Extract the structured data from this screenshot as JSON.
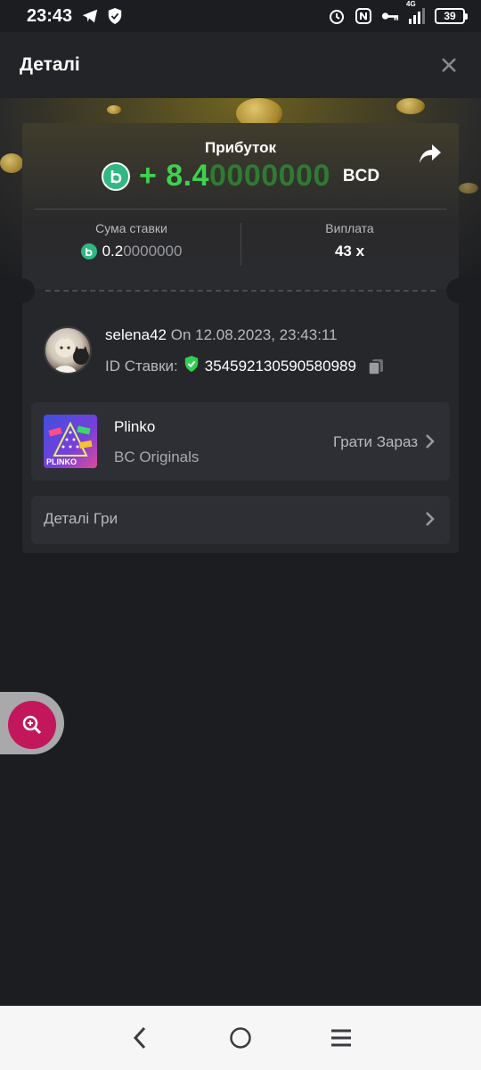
{
  "status_bar": {
    "time": "23:43",
    "network": "4G",
    "battery": "39",
    "icons_left": [
      "telegram-icon",
      "shield-check-icon"
    ],
    "icons_right": [
      "alarm-icon",
      "nfc-icon",
      "key-icon",
      "signal-icon",
      "battery-icon"
    ]
  },
  "header": {
    "title": "Деталі",
    "close_icon": "close-icon"
  },
  "summary": {
    "profit_label": "Прибуток",
    "profit_sign": "+ ",
    "profit_main": "8.4",
    "profit_dim": "0000000",
    "currency": "BCD",
    "bet_amount_label": "Сума ставки",
    "bet_amount_main": "0.2",
    "bet_amount_dim": "0000000",
    "payout_label": "Виплата",
    "payout_value": "43 x"
  },
  "bet_info": {
    "username": "selena42",
    "on_text": " On 12.08.2023, 23:43:11",
    "bet_id_label": "ID Ставки:",
    "bet_id_value": "354592130590580989"
  },
  "game": {
    "name": "Plinko",
    "provider": "BC Originals",
    "play_now": "Грати Зараз",
    "thumb_text": "PLINKO"
  },
  "game_details": {
    "label": "Деталі Гри"
  },
  "colors": {
    "background": "#1c1d20",
    "card": "#26272b",
    "profit_green": "#3ed24f",
    "bc_green": "#2fb883",
    "zoom_button": "#c2185b"
  }
}
